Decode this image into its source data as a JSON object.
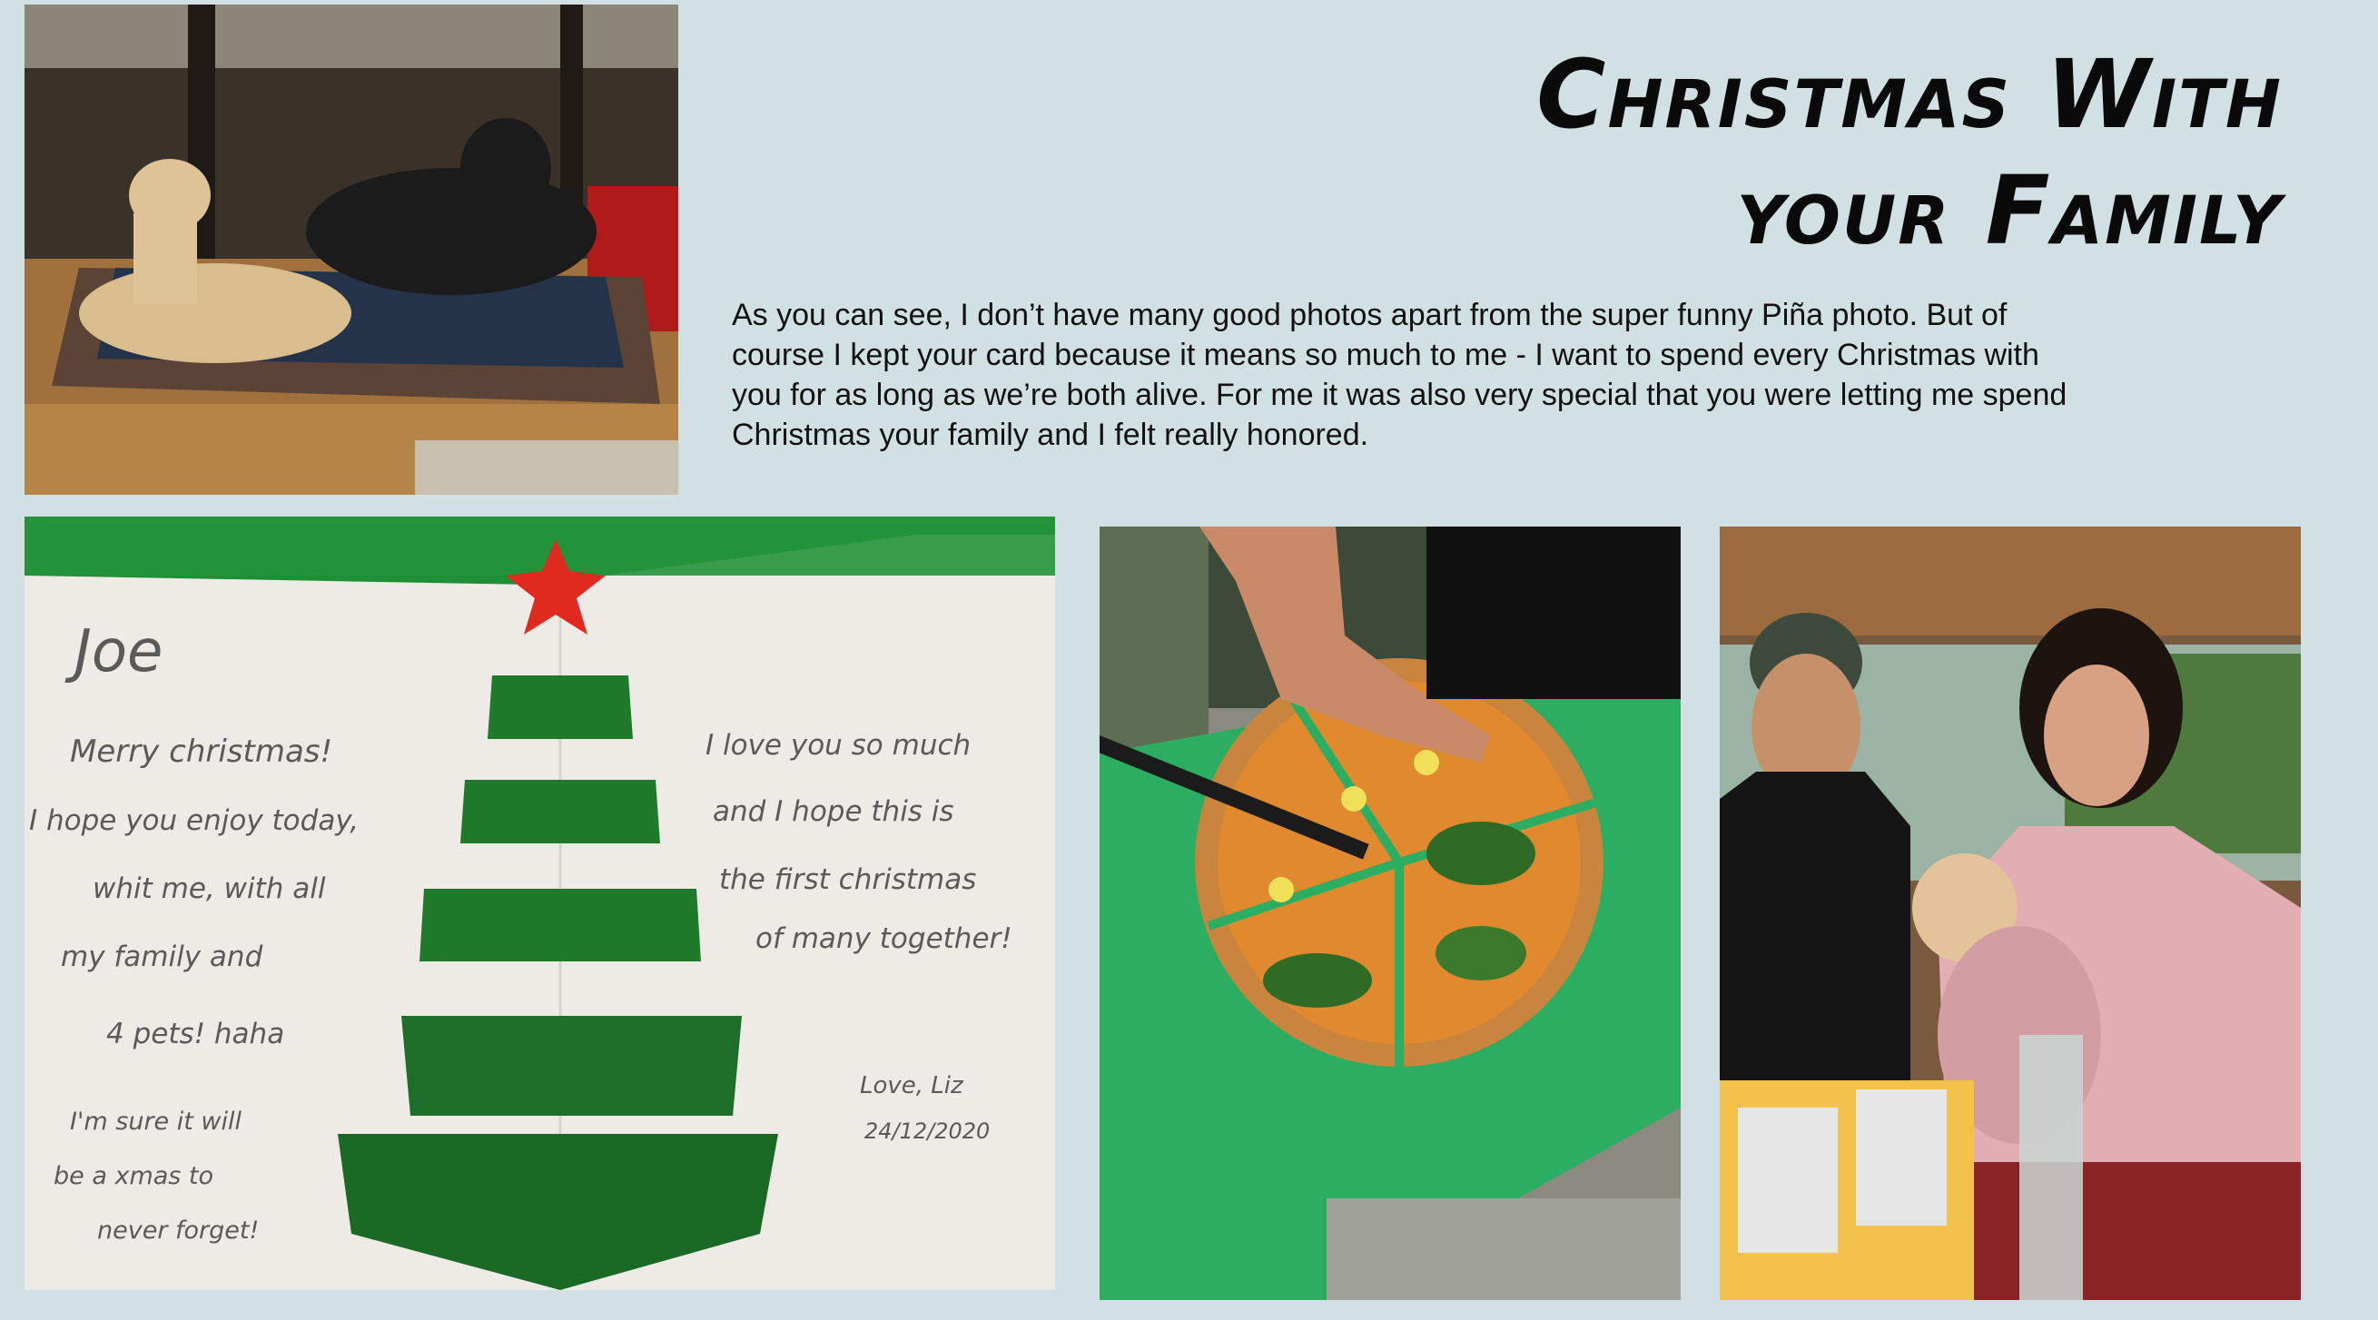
{
  "title": {
    "line1": "Christmas With",
    "line2": "your Family"
  },
  "body_text": "As you can see, I don’t have many good photos apart from the super funny Piña photo. But of course I kept your card because it means so much to me - I want to spend every Christmas with you for as long as we’re both alive. For me it was also very special that you were letting me spend Christmas your family and I felt really honored.",
  "card": {
    "left_lines": [
      "Joe",
      "Merry christmas!",
      "I hope you enjoy today,",
      "whit me, with all",
      "my family and",
      "4 pets! haha",
      "I'm sure it will",
      "be a xmas to",
      "never forget!"
    ],
    "right_lines": [
      "I love you so much",
      "and I hope this is",
      "the first christmas",
      "of many together!"
    ],
    "signature": "Love, Liz",
    "date": "24/12/2020"
  },
  "colors": {
    "background": "#d1e1e3",
    "title": "#0a0a0a",
    "card_green": "#1f8f35",
    "board_green": "#2cae62"
  }
}
